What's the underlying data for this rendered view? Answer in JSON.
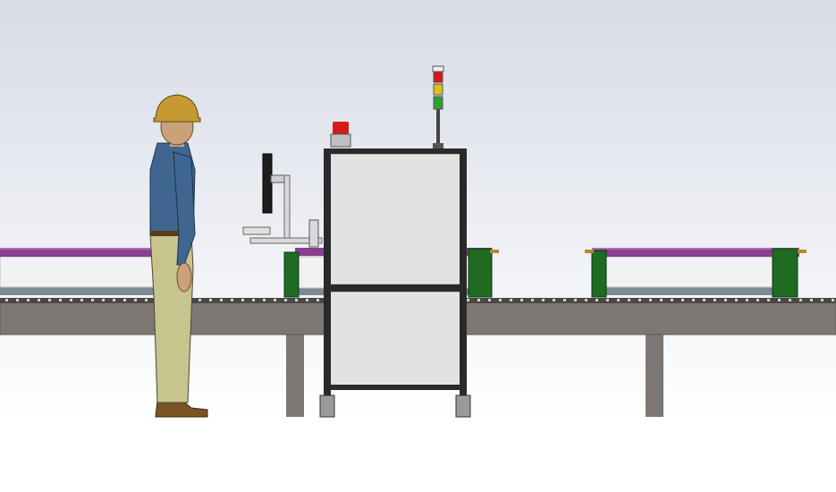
{
  "scene": {
    "background_top": "#d7dbe6",
    "background_bottom": "#ffffff",
    "conveyor_color": "#7d7874",
    "conveyor_edge": "#5e5955",
    "guide_rail_color": "#8a3f8f",
    "guide_rail_light": "#b06ab5",
    "bracket_green": "#1f6b22",
    "cabinet_frame": "#2a2a2a",
    "cabinet_panel": "#e2e2e2",
    "beacon_red": "#d41a1a",
    "tower_colors": [
      "#d41a1a",
      "#d8c21a",
      "#2ea12e"
    ],
    "worker_shirt": "#3f6691",
    "worker_pants": "#c8c48e",
    "worker_helmet": "#c69a32",
    "worker_boots": "#7a5523"
  }
}
